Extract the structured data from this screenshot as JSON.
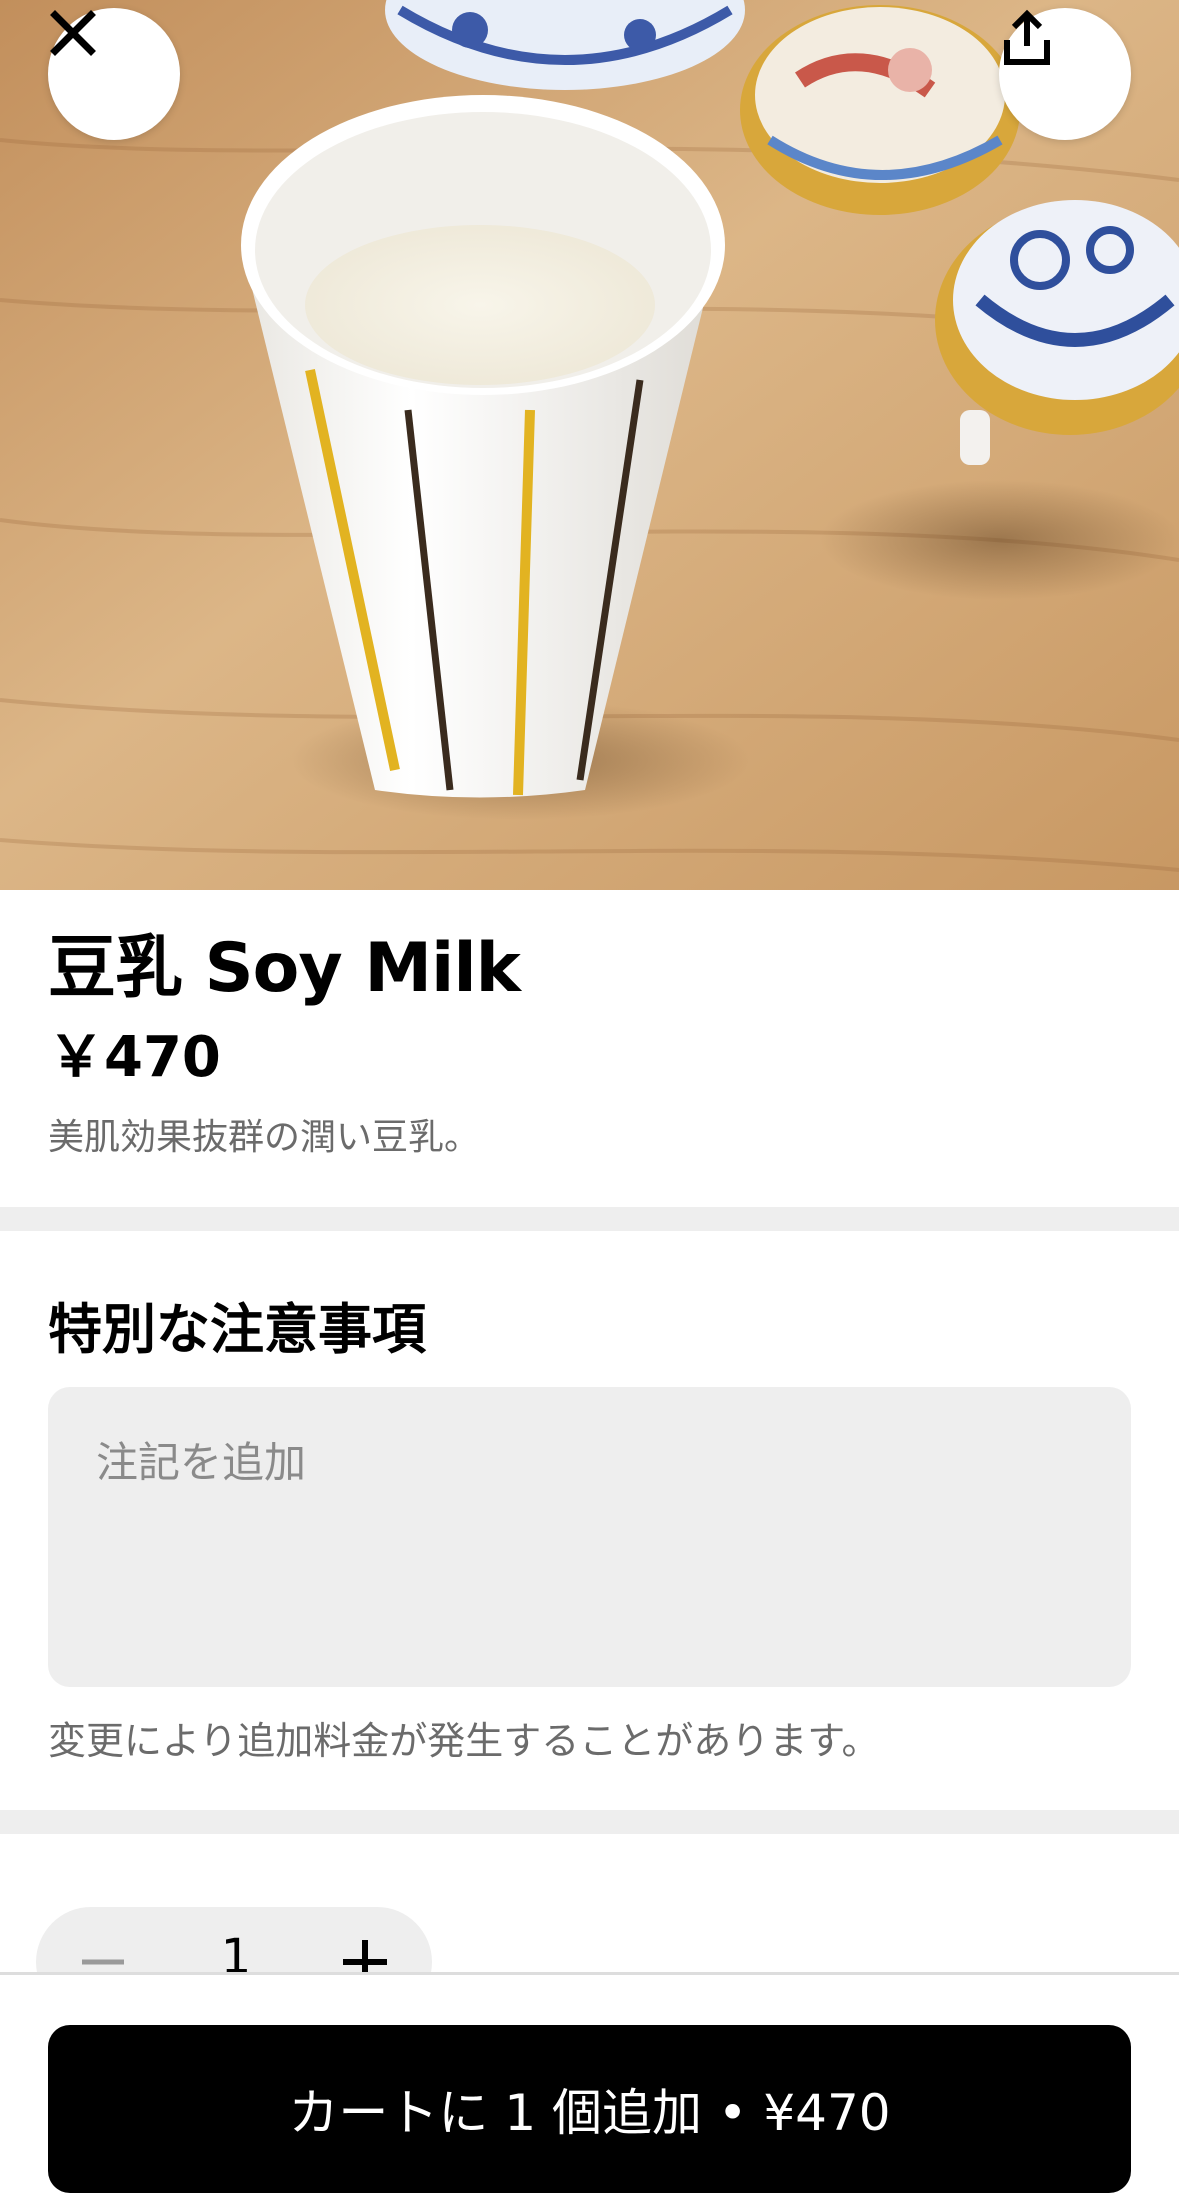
{
  "product": {
    "title": "豆乳 Soy Milk",
    "price": "￥470",
    "description": "美肌効果抜群の潤い豆乳。"
  },
  "special_instructions": {
    "heading": "特別な注意事項",
    "placeholder": "注記を追加",
    "value": "",
    "hint": "変更により追加料金が発生することがあります。"
  },
  "quantity": {
    "value": "1"
  },
  "cart_button": {
    "label": "カートに 1 個追加 • ¥470"
  },
  "icons": {
    "close": "close-icon",
    "share": "share-icon",
    "minus": "minus-icon",
    "plus": "plus-icon"
  },
  "colors": {
    "primary_button": "#000000",
    "surface_gray": "#eeeeee",
    "secondary_text": "#6b6b6b"
  }
}
